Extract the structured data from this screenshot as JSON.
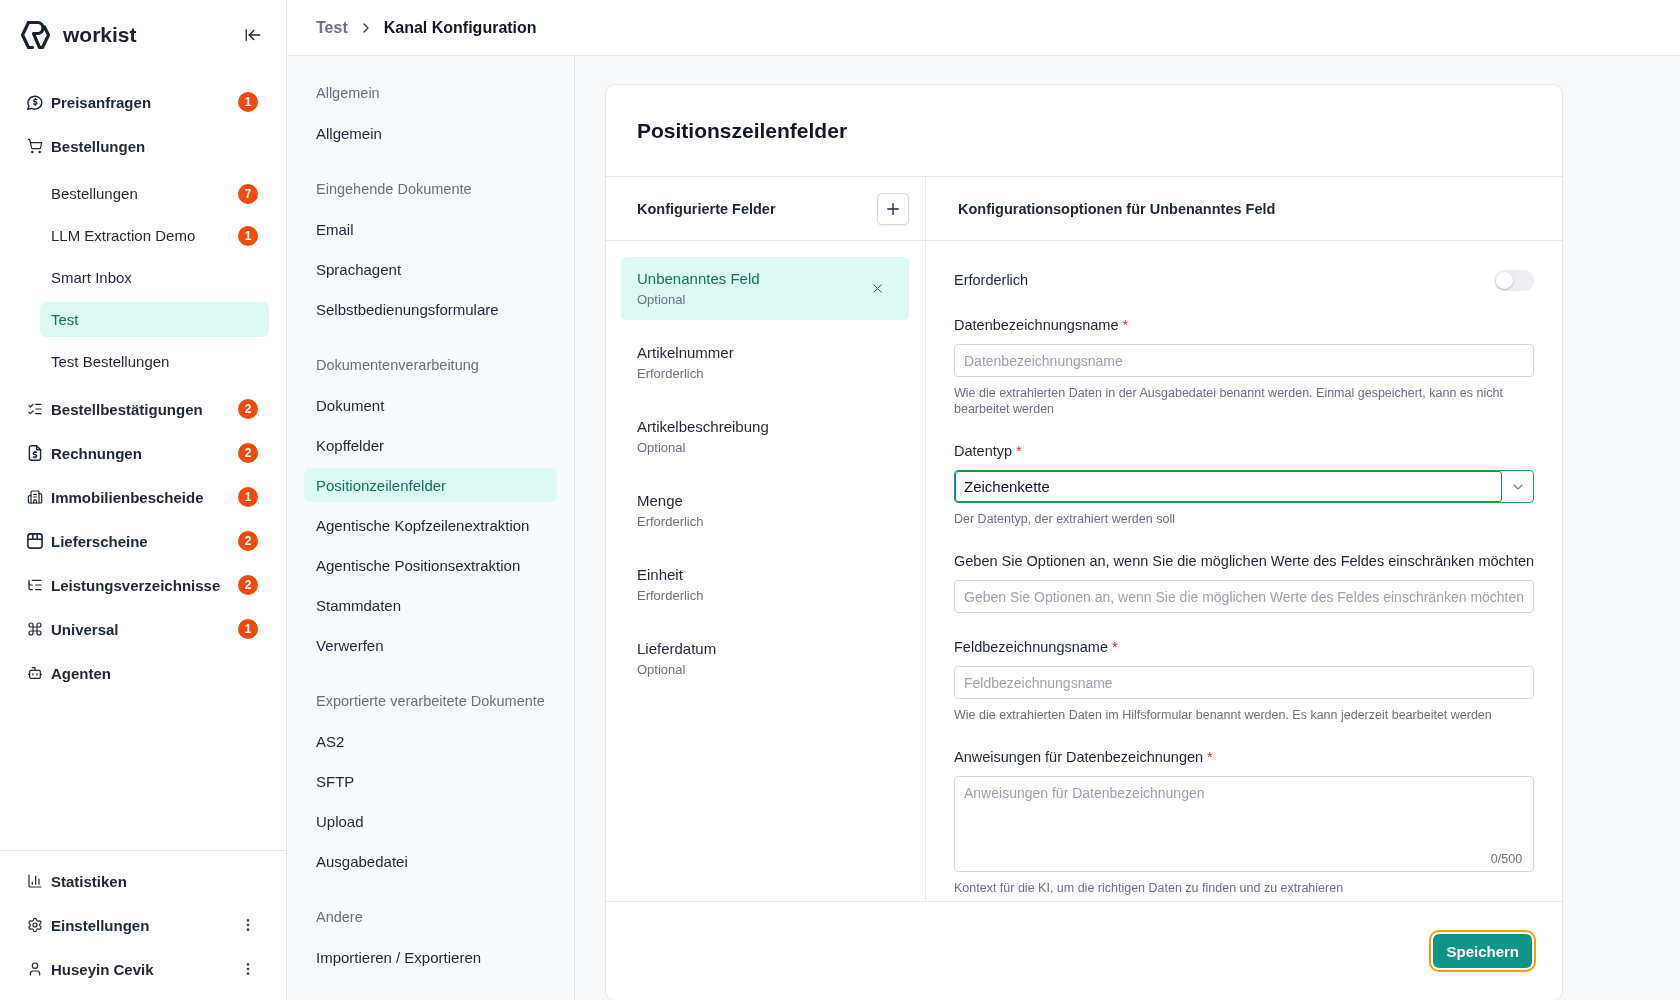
{
  "sidebar": {
    "logo": "workist",
    "items": [
      {
        "label": "Preisanfragen",
        "badge": "1",
        "selected": false
      },
      {
        "label": "Bestellungen",
        "selected": false,
        "children": [
          {
            "label": "Bestellungen",
            "badge": "7",
            "selected": false
          },
          {
            "label": "LLM Extraction Demo",
            "badge": "1",
            "selected": false
          },
          {
            "label": "Smart Inbox",
            "selected": false
          },
          {
            "label": "Test",
            "selected": true
          },
          {
            "label": "Test Bestellungen",
            "selected": false
          }
        ]
      },
      {
        "label": "Bestellbestätigungen",
        "badge": "2",
        "selected": false
      },
      {
        "label": "Rechnungen",
        "badge": "2",
        "selected": false
      },
      {
        "label": "Immobilienbescheide",
        "badge": "1",
        "selected": false
      },
      {
        "label": "Lieferscheine",
        "badge": "2",
        "selected": false
      },
      {
        "label": "Leistungsverzeichnisse",
        "badge": "2",
        "selected": false
      },
      {
        "label": "Universal",
        "badge": "1",
        "selected": false
      },
      {
        "label": "Agenten",
        "selected": false
      }
    ],
    "footer_items": [
      {
        "label": "Statistiken",
        "has_menu": false,
        "selected": false
      },
      {
        "label": "Einstellungen",
        "has_menu": true,
        "selected": false
      },
      {
        "label": "Huseyin Cevik",
        "has_menu": true,
        "selected": false
      }
    ]
  },
  "breadcrumb": [
    {
      "label": "Test",
      "current": false
    },
    {
      "label": "Kanal Konfiguration",
      "current": true
    }
  ],
  "settings_nav": [
    {
      "heading": "Allgemein",
      "items": [
        {
          "label": "Allgemein",
          "selected": false
        }
      ]
    },
    {
      "heading": "Eingehende Dokumente",
      "items": [
        {
          "label": "Email",
          "selected": false
        },
        {
          "label": "Sprachagent",
          "selected": false
        },
        {
          "label": "Selbstbedienungsformulare",
          "selected": false
        }
      ]
    },
    {
      "heading": "Dokumentenverarbeitung",
      "items": [
        {
          "label": "Dokument",
          "selected": false
        },
        {
          "label": "Kopffelder",
          "selected": false
        },
        {
          "label": "Positionzeilenfelder",
          "selected": true
        },
        {
          "label": "Agentische Kopfzeilenextraktion",
          "selected": false
        },
        {
          "label": "Agentische Positionsextraktion",
          "selected": false
        },
        {
          "label": "Stammdaten",
          "selected": false
        },
        {
          "label": "Verwerfen",
          "selected": false
        }
      ]
    },
    {
      "heading": "Exportierte verarbeitete Dokumente",
      "items": [
        {
          "label": "AS2",
          "selected": false
        },
        {
          "label": "SFTP",
          "selected": false
        },
        {
          "label": "Upload",
          "selected": false
        },
        {
          "label": "Ausgabedatei",
          "selected": false
        }
      ]
    },
    {
      "heading": "Andere",
      "items": [
        {
          "label": "Importieren / Exportieren",
          "selected": false
        }
      ]
    }
  ],
  "card": {
    "title": "Positionszeilenfelder",
    "fields_panel": {
      "title": "Konfigurierte Felder",
      "items": [
        {
          "name": "Unbenanntes Feld",
          "requirement": "Optional",
          "selected": true
        },
        {
          "name": "Artikelnummer",
          "requirement": "Erforderlich",
          "selected": false
        },
        {
          "name": "Artikelbeschreibung",
          "requirement": "Optional",
          "selected": false
        },
        {
          "name": "Menge",
          "requirement": "Erforderlich",
          "selected": false
        },
        {
          "name": "Einheit",
          "requirement": "Erforderlich",
          "selected": false
        },
        {
          "name": "Lieferdatum",
          "requirement": "Optional",
          "selected": false
        }
      ]
    },
    "options_panel": {
      "title": "Konfigurationsoptionen für Unbenanntes Feld",
      "required_marker": "*",
      "toggle": {
        "label": "Erforderlich",
        "on": false
      },
      "fields": [
        {
          "kind": "input",
          "label": "Datenbezeichnungsname",
          "required": true,
          "focused": false,
          "placeholder": "Datenbezeichnungsname",
          "help": "Wie die extrahierten Daten in der Ausgabedatei benannt werden. Einmal gespeichert, kann es nicht bearbeitet werden"
        },
        {
          "kind": "select",
          "label": "Datentyp",
          "required": true,
          "focused": true,
          "value": "Zeichenkette",
          "help": "Der Datentyp, der extrahiert werden soll"
        },
        {
          "kind": "input",
          "label": "Geben Sie Optionen an, wenn Sie die möglichen Werte des Feldes einschränken möchten",
          "required": false,
          "focused": false,
          "placeholder": "Geben Sie Optionen an, wenn Sie die möglichen Werte des Feldes einschränken möchten"
        },
        {
          "kind": "input",
          "label": "Feldbezeichnungsname",
          "required": true,
          "focused": false,
          "placeholder": "Feldbezeichnungsname",
          "help": "Wie die extrahierten Daten im Hilfsformular benannt werden. Es kann jederzeit bearbeitet werden"
        },
        {
          "kind": "textarea",
          "label": "Anweisungen für Datenbezeichnungen",
          "required": true,
          "focused": false,
          "placeholder": "Anweisungen für Datenbezeichnungen",
          "counter": "0/500",
          "help": "Kontext für die KI, um die richtigen Daten zu finden und zu extrahieren"
        }
      ]
    },
    "save_button": {
      "label": "Speichern",
      "focused": true
    }
  }
}
